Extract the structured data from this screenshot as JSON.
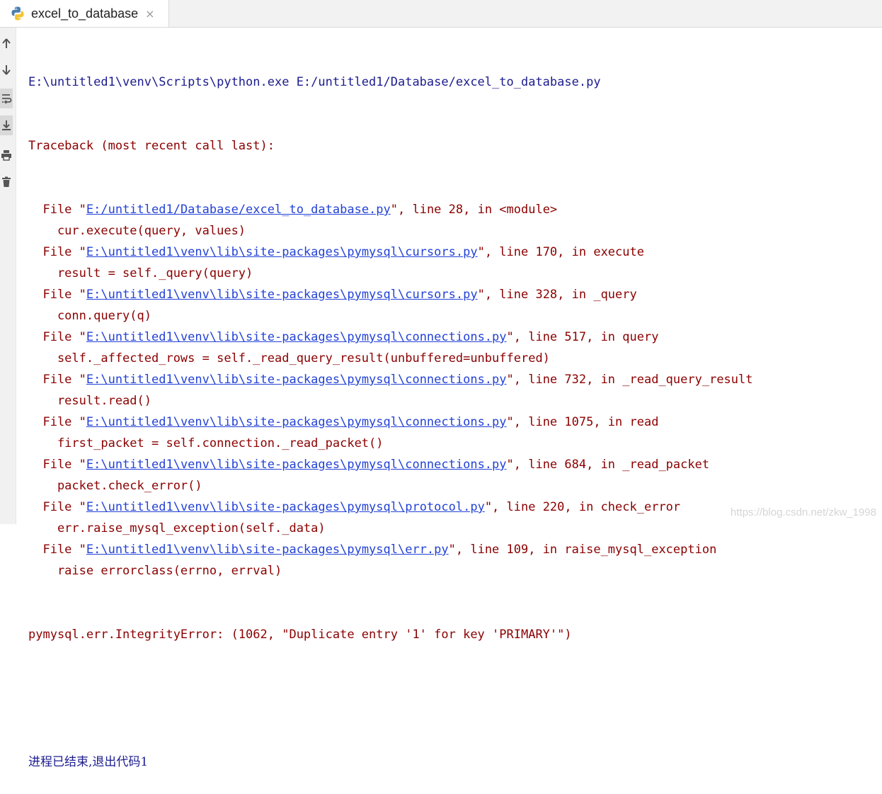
{
  "tab": {
    "title": "excel_to_database",
    "close_glyph": "×",
    "icon": "python-icon"
  },
  "gutter": {
    "buttons": [
      "up-arrow-icon",
      "down-arrow-icon",
      "soft-wrap-icon",
      "scroll-to-end-icon",
      "print-icon",
      "trash-icon"
    ]
  },
  "console": {
    "command": "E:\\untitled1\\venv\\Scripts\\python.exe E:/untitled1/Database/excel_to_database.py",
    "traceback_header": "Traceback (most recent call last):",
    "frames": [
      {
        "prefix": "  File \"",
        "path": "E:/untitled1/Database/excel_to_database.py",
        "suffix": "\", line 28, in <module>",
        "code": "    cur.execute(query, values)"
      },
      {
        "prefix": "  File \"",
        "path": "E:\\untitled1\\venv\\lib\\site-packages\\pymysql\\cursors.py",
        "suffix": "\", line 170, in execute",
        "code": "    result = self._query(query)"
      },
      {
        "prefix": "  File \"",
        "path": "E:\\untitled1\\venv\\lib\\site-packages\\pymysql\\cursors.py",
        "suffix": "\", line 328, in _query",
        "code": "    conn.query(q)"
      },
      {
        "prefix": "  File \"",
        "path": "E:\\untitled1\\venv\\lib\\site-packages\\pymysql\\connections.py",
        "suffix": "\", line 517, in query",
        "code": "    self._affected_rows = self._read_query_result(unbuffered=unbuffered)"
      },
      {
        "prefix": "  File \"",
        "path": "E:\\untitled1\\venv\\lib\\site-packages\\pymysql\\connections.py",
        "suffix": "\", line 732, in _read_query_result",
        "code": "    result.read()"
      },
      {
        "prefix": "  File \"",
        "path": "E:\\untitled1\\venv\\lib\\site-packages\\pymysql\\connections.py",
        "suffix": "\", line 1075, in read",
        "code": "    first_packet = self.connection._read_packet()"
      },
      {
        "prefix": "  File \"",
        "path": "E:\\untitled1\\venv\\lib\\site-packages\\pymysql\\connections.py",
        "suffix": "\", line 684, in _read_packet",
        "code": "    packet.check_error()"
      },
      {
        "prefix": "  File \"",
        "path": "E:\\untitled1\\venv\\lib\\site-packages\\pymysql\\protocol.py",
        "suffix": "\", line 220, in check_error",
        "code": "    err.raise_mysql_exception(self._data)"
      },
      {
        "prefix": "  File \"",
        "path": "E:\\untitled1\\venv\\lib\\site-packages\\pymysql\\err.py",
        "suffix": "\", line 109, in raise_mysql_exception",
        "code": "    raise errorclass(errno, errval)"
      }
    ],
    "error_line": "pymysql.err.IntegrityError: (1062, \"Duplicate entry '1' for key 'PRIMARY'\")",
    "exit_message": "进程已结束,退出代码1"
  },
  "watermark": "https://blog.csdn.net/zkw_1998",
  "colors": {
    "command": "#1b1b8f",
    "error": "#8b0000",
    "link": "#2342d6"
  }
}
